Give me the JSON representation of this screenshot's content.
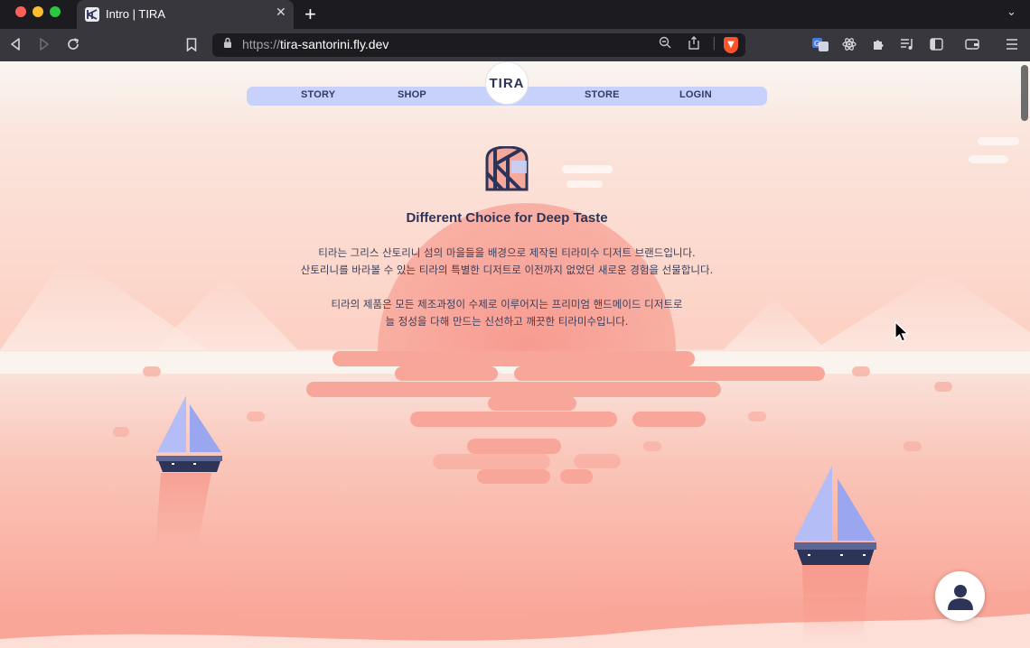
{
  "browser": {
    "tab_title": "Intro | TIRA",
    "url_scheme": "https://",
    "url_host": "tira-santorini.fly.dev"
  },
  "nav": {
    "logo": "TIRA",
    "items": [
      "STORY",
      "SHOP",
      "STORE",
      "LOGIN"
    ]
  },
  "hero": {
    "headline": "Different Choice for Deep Taste",
    "paragraph1": [
      "티라는 그리스 산토리니 섬의 마을들을 배경으로 제작된 티라미수 디저트 브랜드입니다.",
      "산토리니를 바라볼 수 있는 티라의 특별한 디저트로 이전까지 없었던 새로운 경험을 선물합니다."
    ],
    "paragraph2": [
      "티라의 제품은 모든 제조과정이 수제로 이루어지는 프리미엄 핸드메이드 디저트로",
      "늘 정성을 다해 만드는 신선하고 깨끗한 티라미수입니다."
    ]
  },
  "colors": {
    "nav_bg": "#c7d1fb",
    "navy": "#2e3358",
    "sun": "#f89a8e",
    "sail": "#a9b4f4"
  },
  "icons": [
    "back-icon",
    "forward-icon",
    "reload-icon",
    "bookmark-icon",
    "lock-icon",
    "zoom-icon",
    "share-icon",
    "brave-shield-icon",
    "translate-icon",
    "react-devtools-icon",
    "extensions-icon",
    "playlist-icon",
    "sidebar-icon",
    "wallet-icon",
    "menu-icon",
    "user-icon",
    "cursor-icon"
  ]
}
